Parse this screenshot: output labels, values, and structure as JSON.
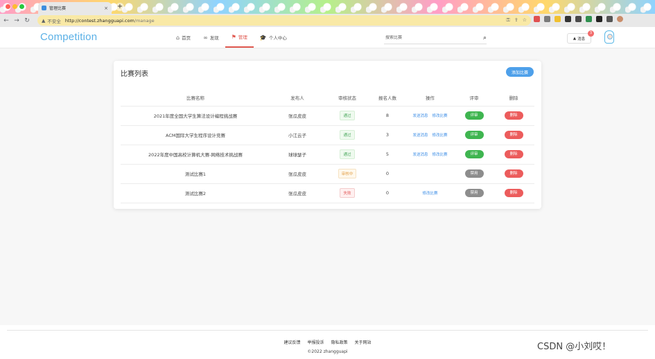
{
  "browser": {
    "tab_title": "管理比赛",
    "tab_close": "×",
    "new_tab": "+",
    "insecure_label": "不安全",
    "url_host": "http://contest.zhangguapi.com",
    "url_path": "/manage"
  },
  "header": {
    "logo": "Competition",
    "nav": [
      {
        "icon": "home-icon",
        "label": "首页"
      },
      {
        "icon": "discover-icon",
        "label": "发现"
      },
      {
        "icon": "flag-icon",
        "label": "管理"
      },
      {
        "icon": "graduation-cap-icon",
        "label": "个人中心"
      }
    ],
    "search_placeholder": "搜索比赛",
    "message_label": "消息",
    "message_count": "3"
  },
  "card": {
    "title": "比赛列表",
    "add_button": "添加比赛",
    "columns": [
      "比赛名称",
      "发布人",
      "审核状态",
      "报名人数",
      "操作",
      "评审",
      "删除"
    ],
    "rows": [
      {
        "name": "2021年度全国大学生算法设计编程挑战赛",
        "publisher": "张瓜皮皮",
        "status": "通过",
        "status_kind": "pass",
        "count": "8",
        "op1": "发送消息",
        "op2": "修改比赛",
        "review": "评审",
        "review_kind": "green",
        "delete": "删除"
      },
      {
        "name": "ACM国际大学生程序设计竞赛",
        "publisher": "小江云子",
        "status": "通过",
        "status_kind": "pass",
        "count": "3",
        "op1": "发送消息",
        "op2": "修改比赛",
        "review": "评审",
        "review_kind": "green",
        "delete": "删除"
      },
      {
        "name": "2022年度中国高校计算机大赛-网络技术挑战赛",
        "publisher": "球球瑟子",
        "status": "通过",
        "status_kind": "pass",
        "count": "5",
        "op1": "发送消息",
        "op2": "修改比赛",
        "review": "评审",
        "review_kind": "green",
        "delete": "删除"
      },
      {
        "name": "测试比赛1",
        "publisher": "张瓜皮皮",
        "status": "审核中",
        "status_kind": "pending",
        "count": "0",
        "op1": "",
        "op2": "",
        "review": "禁用",
        "review_kind": "gray",
        "delete": "删除"
      },
      {
        "name": "测试比赛2",
        "publisher": "张瓜皮皮",
        "status": "失败",
        "status_kind": "fail",
        "count": "0",
        "op1": "",
        "op2": "修改比赛",
        "review": "禁用",
        "review_kind": "gray",
        "delete": "删除"
      }
    ]
  },
  "footer": {
    "links": [
      "建议反馈",
      "举报投诉",
      "隐私政策",
      "关于网站"
    ],
    "copyright": "©2022 zhangguapi"
  },
  "watermark": "CSDN @小刘哎！",
  "colors": {
    "accent": "#e0584f",
    "primary": "#4ea0ea",
    "logo": "#5ab0e6"
  }
}
